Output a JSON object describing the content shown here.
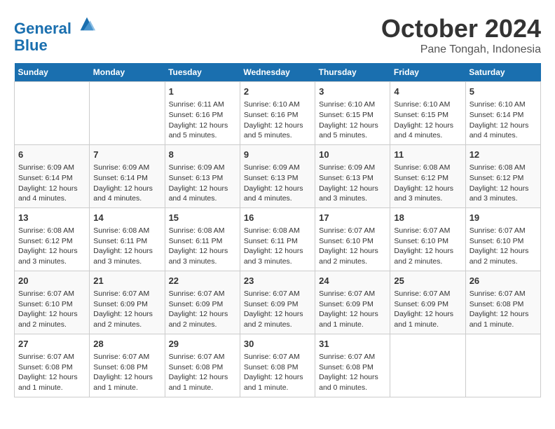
{
  "header": {
    "logo_line1": "General",
    "logo_line2": "Blue",
    "title": "October 2024",
    "subtitle": "Pane Tongah, Indonesia"
  },
  "days_of_week": [
    "Sunday",
    "Monday",
    "Tuesday",
    "Wednesday",
    "Thursday",
    "Friday",
    "Saturday"
  ],
  "weeks": [
    [
      {
        "day": "",
        "info": ""
      },
      {
        "day": "",
        "info": ""
      },
      {
        "day": "1",
        "info": "Sunrise: 6:11 AM\nSunset: 6:16 PM\nDaylight: 12 hours and 5 minutes."
      },
      {
        "day": "2",
        "info": "Sunrise: 6:10 AM\nSunset: 6:16 PM\nDaylight: 12 hours and 5 minutes."
      },
      {
        "day": "3",
        "info": "Sunrise: 6:10 AM\nSunset: 6:15 PM\nDaylight: 12 hours and 5 minutes."
      },
      {
        "day": "4",
        "info": "Sunrise: 6:10 AM\nSunset: 6:15 PM\nDaylight: 12 hours and 4 minutes."
      },
      {
        "day": "5",
        "info": "Sunrise: 6:10 AM\nSunset: 6:14 PM\nDaylight: 12 hours and 4 minutes."
      }
    ],
    [
      {
        "day": "6",
        "info": "Sunrise: 6:09 AM\nSunset: 6:14 PM\nDaylight: 12 hours and 4 minutes."
      },
      {
        "day": "7",
        "info": "Sunrise: 6:09 AM\nSunset: 6:14 PM\nDaylight: 12 hours and 4 minutes."
      },
      {
        "day": "8",
        "info": "Sunrise: 6:09 AM\nSunset: 6:13 PM\nDaylight: 12 hours and 4 minutes."
      },
      {
        "day": "9",
        "info": "Sunrise: 6:09 AM\nSunset: 6:13 PM\nDaylight: 12 hours and 4 minutes."
      },
      {
        "day": "10",
        "info": "Sunrise: 6:09 AM\nSunset: 6:13 PM\nDaylight: 12 hours and 3 minutes."
      },
      {
        "day": "11",
        "info": "Sunrise: 6:08 AM\nSunset: 6:12 PM\nDaylight: 12 hours and 3 minutes."
      },
      {
        "day": "12",
        "info": "Sunrise: 6:08 AM\nSunset: 6:12 PM\nDaylight: 12 hours and 3 minutes."
      }
    ],
    [
      {
        "day": "13",
        "info": "Sunrise: 6:08 AM\nSunset: 6:12 PM\nDaylight: 12 hours and 3 minutes."
      },
      {
        "day": "14",
        "info": "Sunrise: 6:08 AM\nSunset: 6:11 PM\nDaylight: 12 hours and 3 minutes."
      },
      {
        "day": "15",
        "info": "Sunrise: 6:08 AM\nSunset: 6:11 PM\nDaylight: 12 hours and 3 minutes."
      },
      {
        "day": "16",
        "info": "Sunrise: 6:08 AM\nSunset: 6:11 PM\nDaylight: 12 hours and 3 minutes."
      },
      {
        "day": "17",
        "info": "Sunrise: 6:07 AM\nSunset: 6:10 PM\nDaylight: 12 hours and 2 minutes."
      },
      {
        "day": "18",
        "info": "Sunrise: 6:07 AM\nSunset: 6:10 PM\nDaylight: 12 hours and 2 minutes."
      },
      {
        "day": "19",
        "info": "Sunrise: 6:07 AM\nSunset: 6:10 PM\nDaylight: 12 hours and 2 minutes."
      }
    ],
    [
      {
        "day": "20",
        "info": "Sunrise: 6:07 AM\nSunset: 6:10 PM\nDaylight: 12 hours and 2 minutes."
      },
      {
        "day": "21",
        "info": "Sunrise: 6:07 AM\nSunset: 6:09 PM\nDaylight: 12 hours and 2 minutes."
      },
      {
        "day": "22",
        "info": "Sunrise: 6:07 AM\nSunset: 6:09 PM\nDaylight: 12 hours and 2 minutes."
      },
      {
        "day": "23",
        "info": "Sunrise: 6:07 AM\nSunset: 6:09 PM\nDaylight: 12 hours and 2 minutes."
      },
      {
        "day": "24",
        "info": "Sunrise: 6:07 AM\nSunset: 6:09 PM\nDaylight: 12 hours and 1 minute."
      },
      {
        "day": "25",
        "info": "Sunrise: 6:07 AM\nSunset: 6:09 PM\nDaylight: 12 hours and 1 minute."
      },
      {
        "day": "26",
        "info": "Sunrise: 6:07 AM\nSunset: 6:08 PM\nDaylight: 12 hours and 1 minute."
      }
    ],
    [
      {
        "day": "27",
        "info": "Sunrise: 6:07 AM\nSunset: 6:08 PM\nDaylight: 12 hours and 1 minute."
      },
      {
        "day": "28",
        "info": "Sunrise: 6:07 AM\nSunset: 6:08 PM\nDaylight: 12 hours and 1 minute."
      },
      {
        "day": "29",
        "info": "Sunrise: 6:07 AM\nSunset: 6:08 PM\nDaylight: 12 hours and 1 minute."
      },
      {
        "day": "30",
        "info": "Sunrise: 6:07 AM\nSunset: 6:08 PM\nDaylight: 12 hours and 1 minute."
      },
      {
        "day": "31",
        "info": "Sunrise: 6:07 AM\nSunset: 6:08 PM\nDaylight: 12 hours and 0 minutes."
      },
      {
        "day": "",
        "info": ""
      },
      {
        "day": "",
        "info": ""
      }
    ]
  ]
}
